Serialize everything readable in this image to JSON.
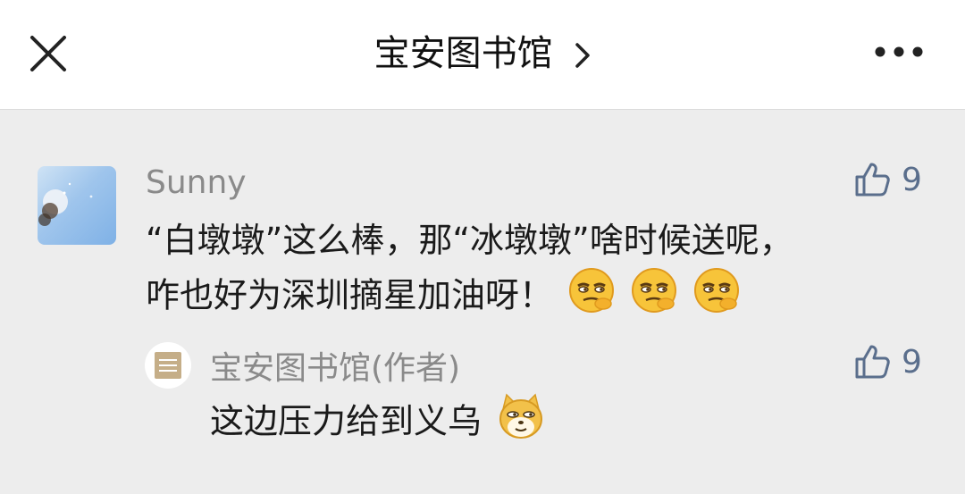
{
  "header": {
    "title": "宝安图书馆",
    "close_icon": "close-icon",
    "chevron_icon": "chevron-right-icon",
    "more_icon": "more-dots-icon"
  },
  "comments": [
    {
      "author": "Sunny",
      "avatar": "photo-avatar",
      "text_line1": "“白墩墩”这么棒，那“冰墩墩”啥时候送呢，",
      "text_line2": "咋也好为深圳摘星加油呀！",
      "emojis": [
        "smirk-emoji",
        "smirk-emoji",
        "smirk-emoji"
      ],
      "likes": "9",
      "like_icon": "thumbs-up-icon"
    }
  ],
  "reply": {
    "author": "宝安图书馆(作者)",
    "avatar": "library-logo",
    "text": "这边压力给到义乌",
    "emoji": "doge-emoji",
    "likes": "9",
    "like_icon": "thumbs-up-icon"
  },
  "colors": {
    "background": "#ededed",
    "header_bg": "#ffffff",
    "name_gray": "#8a8a8a",
    "like_blue": "#5a6e8c"
  }
}
